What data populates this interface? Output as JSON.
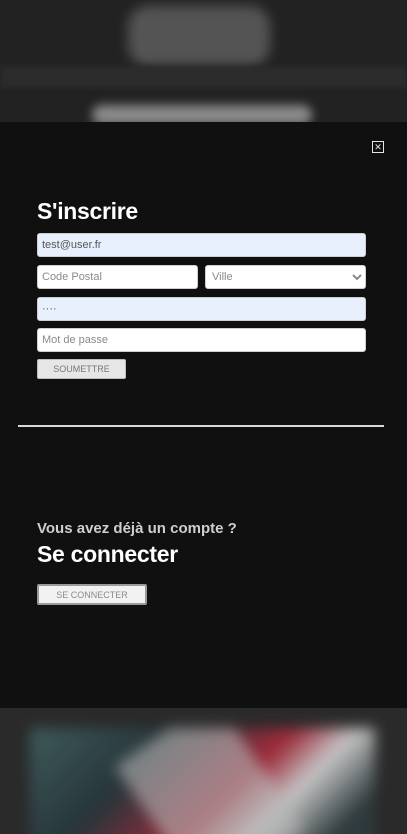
{
  "signup": {
    "title": "S'inscrire",
    "email_value": "test@user.fr",
    "postal_placeholder": "Code Postal",
    "city_selected": "Ville",
    "password_value": "····",
    "password_placeholder": "Mot de passe",
    "submit_label": "SOUMETTRE"
  },
  "login": {
    "question": "Vous avez déjà un compte ?",
    "title": "Se connecter",
    "button_label": "SE CONNECTER"
  },
  "modal": {
    "close_icon": "close-icon",
    "close_glyph": "✕"
  },
  "colors": {
    "modal_bg": "#101010",
    "autofill_bg": "#e8f0fe"
  }
}
